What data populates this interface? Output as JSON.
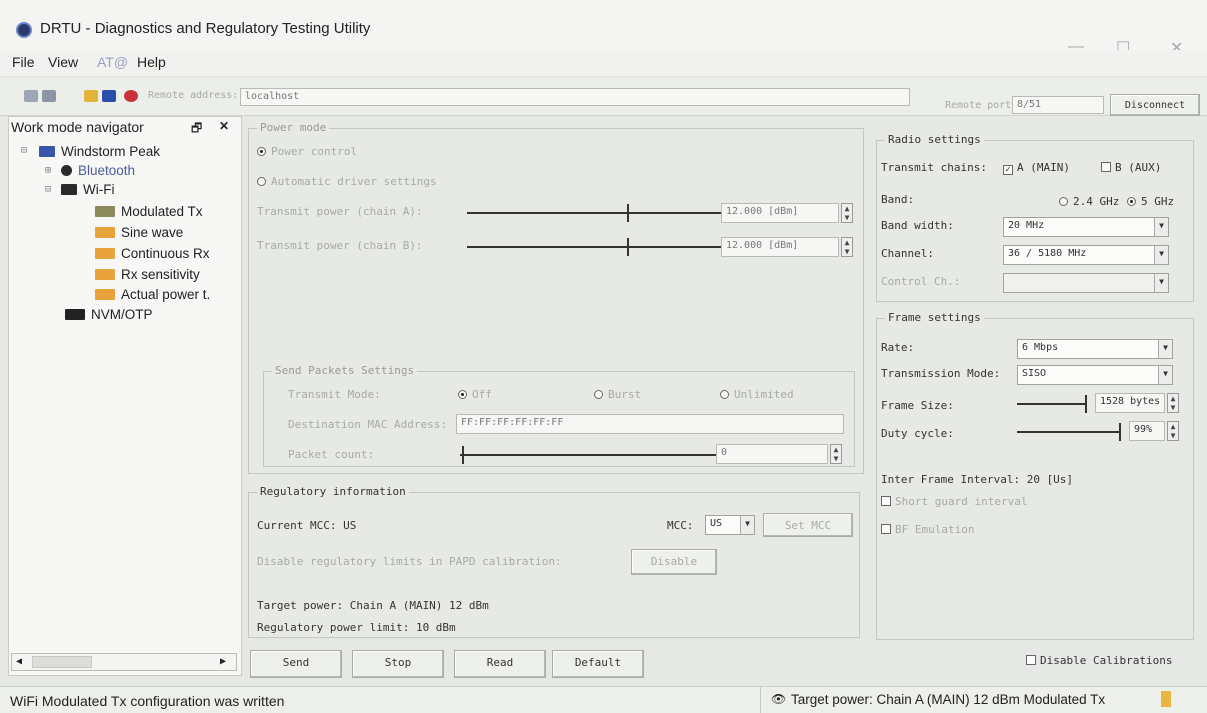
{
  "window": {
    "title": "DRTU - Diagnostics and Regulatory Testing Utility",
    "minimize": "—",
    "maximize": "☐",
    "close": "✕"
  },
  "menu": [
    "File",
    "View",
    "AT@",
    "Help"
  ],
  "toolbar": {
    "remote_address_label": "Remote address:",
    "remote_address_value": "localhost",
    "remote_port_label": "Remote port:",
    "remote_port_value": "8/51",
    "disconnect_label": "Disconnect"
  },
  "navigator": {
    "title": "Work mode navigator",
    "pin": "🗗",
    "close": "✕",
    "items": [
      {
        "label": "Windstorm Peak"
      },
      {
        "label": "Bluetooth"
      },
      {
        "label": "Wi-Fi"
      },
      {
        "label": "Modulated Tx"
      },
      {
        "label": "Sine wave"
      },
      {
        "label": "Continuous Rx"
      },
      {
        "label": "Rx sensitivity"
      },
      {
        "label": "Actual power t."
      },
      {
        "label": "NVM/OTP"
      }
    ]
  },
  "power_mode": {
    "title": "Power mode",
    "power_control": "Power control",
    "auto_driver": "Automatic driver settings",
    "tx_power_a_label": "Transmit power (chain A):",
    "tx_power_a_value": "12.000 [dBm]",
    "tx_power_b_label": "Transmit power (chain B):",
    "tx_power_b_value": "12.000 [dBm]"
  },
  "send_packets": {
    "title": "Send Packets Settings",
    "transmit_mode_label": "Transmit Mode:",
    "mode_off": "Off",
    "mode_burst": "Burst",
    "mode_unlimited": "Unlimited",
    "dest_mac_label": "Destination MAC Address:",
    "dest_mac_value": "FF:FF:FF:FF:FF:FF",
    "packet_count_label": "Packet count:",
    "packet_count_value": "0"
  },
  "regulatory": {
    "title": "Regulatory information",
    "current_mcc": "Current MCC: US",
    "mcc_label": "MCC:",
    "mcc_value": "US",
    "set_mcc": "Set MCC",
    "disable_label": "Disable regulatory limits in PAPD calibration:",
    "disable_button": "Disable",
    "target_power": "Target power: Chain A (MAIN) 12 dBm",
    "power_limit": "Regulatory power limit: 10 dBm"
  },
  "radio": {
    "title": "Radio settings",
    "tx_chains_label": "Transmit chains:",
    "chain_a": "A (MAIN)",
    "chain_b": "B (AUX)",
    "band_label": "Band:",
    "band_24": "2.4 GHz",
    "band_5": "5 GHz",
    "bandwidth_label": "Band width:",
    "bandwidth_value": "20 MHz",
    "channel_label": "Channel:",
    "channel_value": "36 / 5180 MHz",
    "control_ch_label": "Control Ch.:",
    "control_ch_value": ""
  },
  "frame": {
    "title": "Frame settings",
    "rate_label": "Rate:",
    "rate_value": "6 Mbps",
    "tx_mode_label": "Transmission Mode:",
    "tx_mode_value": "SISO",
    "frame_size_label": "Frame Size:",
    "frame_size_value": "1528 bytes",
    "duty_label": "Duty cycle:",
    "duty_value": "99%",
    "ifi": "Inter Frame Interval: 20 [Us]",
    "short_guard": "Short guard interval",
    "bf_emulation": "BF Emulation"
  },
  "actions": {
    "send": "Send",
    "stop": "Stop",
    "read": "Read",
    "default": "Default",
    "disable_calibrations": "Disable Calibrations"
  },
  "status": {
    "left": "WiFi Modulated Tx configuration was written",
    "right": "Target power: Chain A (MAIN) 12 dBm  Modulated Tx"
  }
}
